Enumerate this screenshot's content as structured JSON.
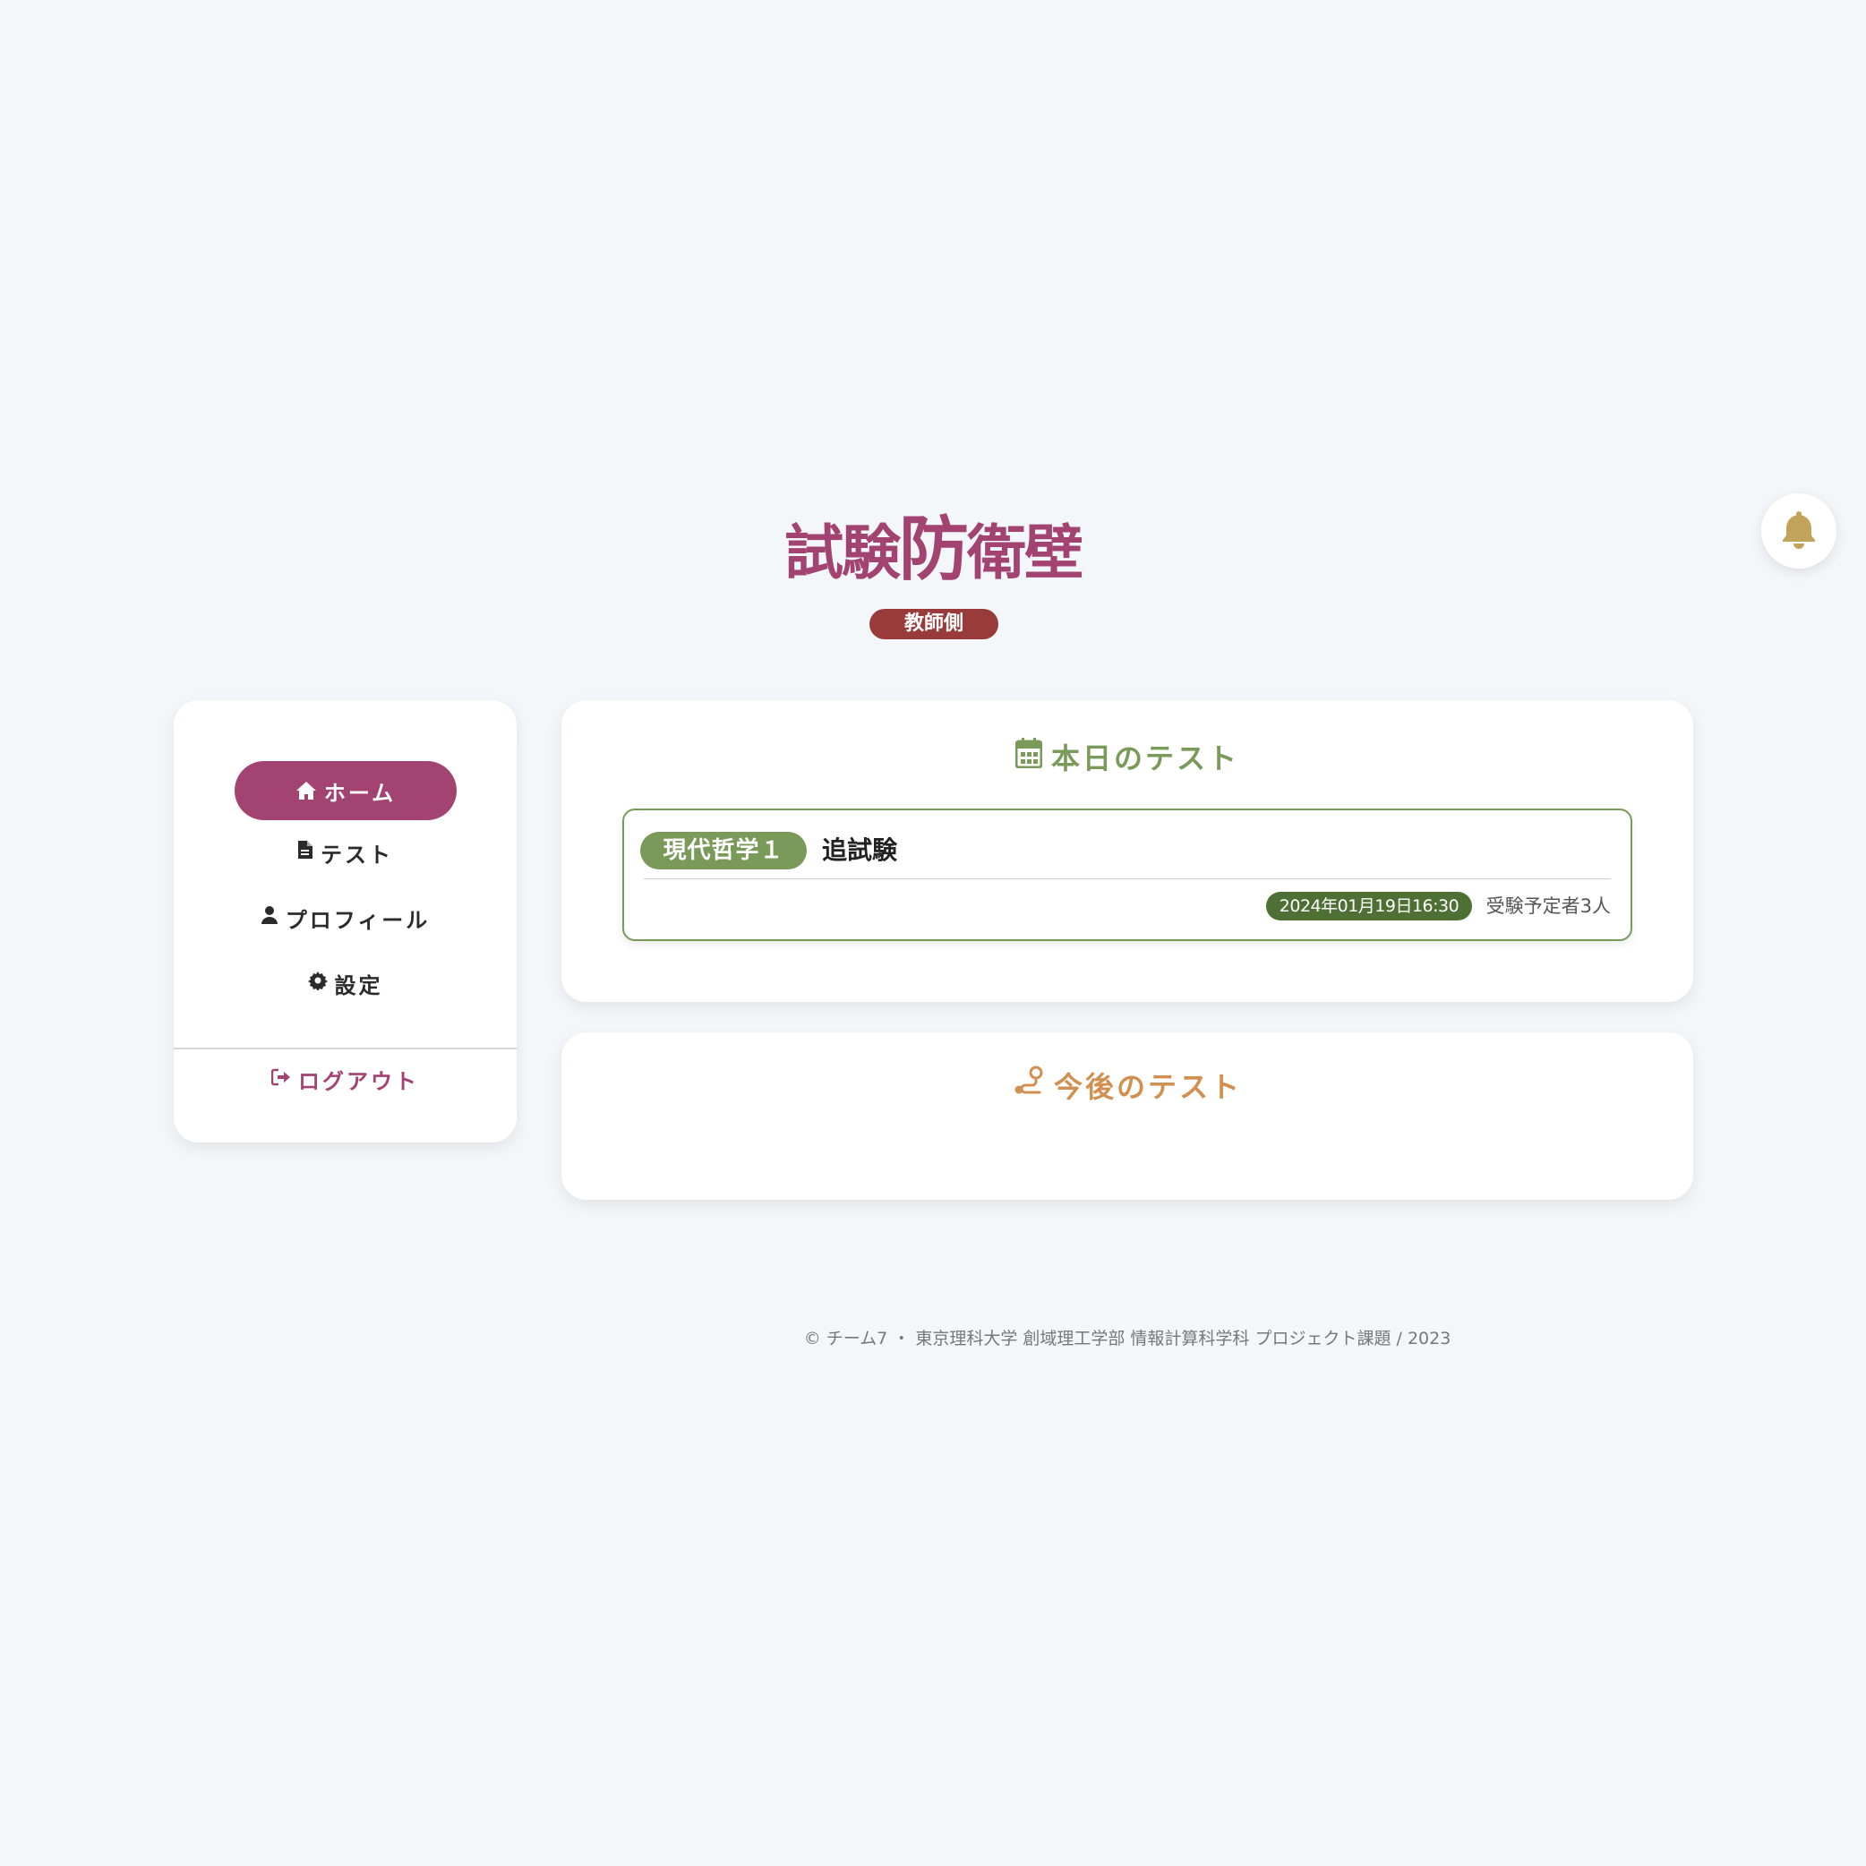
{
  "header": {
    "logo_part1": "試験",
    "logo_part2": "防",
    "logo_part3": "衛壁",
    "role_badge": "教師側",
    "notification_icon": "bell-icon"
  },
  "sidebar": {
    "items": [
      {
        "label": "ホーム",
        "icon": "home-icon"
      },
      {
        "label": "テスト",
        "icon": "file-icon"
      },
      {
        "label": "プロフィール",
        "icon": "user-icon"
      },
      {
        "label": "設定",
        "icon": "gear-icon"
      }
    ],
    "logout": {
      "label": "ログアウト",
      "icon": "sign-out-icon"
    }
  },
  "today": {
    "title": "本日のテスト",
    "icon": "calendar-icon",
    "tests": [
      {
        "subject": "現代哲学１",
        "type": "追試験",
        "datetime": "2024年01月19日16:30",
        "examinees": "受験予定者3人"
      }
    ]
  },
  "future": {
    "title": "今後のテスト",
    "icon": "route-icon"
  },
  "footer": {
    "text": "© チーム7 ・ 東京理科大学 創域理工学部 情報計算科学科 プロジェクト課題 / 2023"
  },
  "colors": {
    "brand": "#a24372",
    "role_badge": "#9a3b3b",
    "today_accent": "#7a9a5a",
    "date_badge": "#4f7035",
    "future_accent": "#d19050",
    "bell": "#c1a35a",
    "background": "#f4f7fa"
  }
}
